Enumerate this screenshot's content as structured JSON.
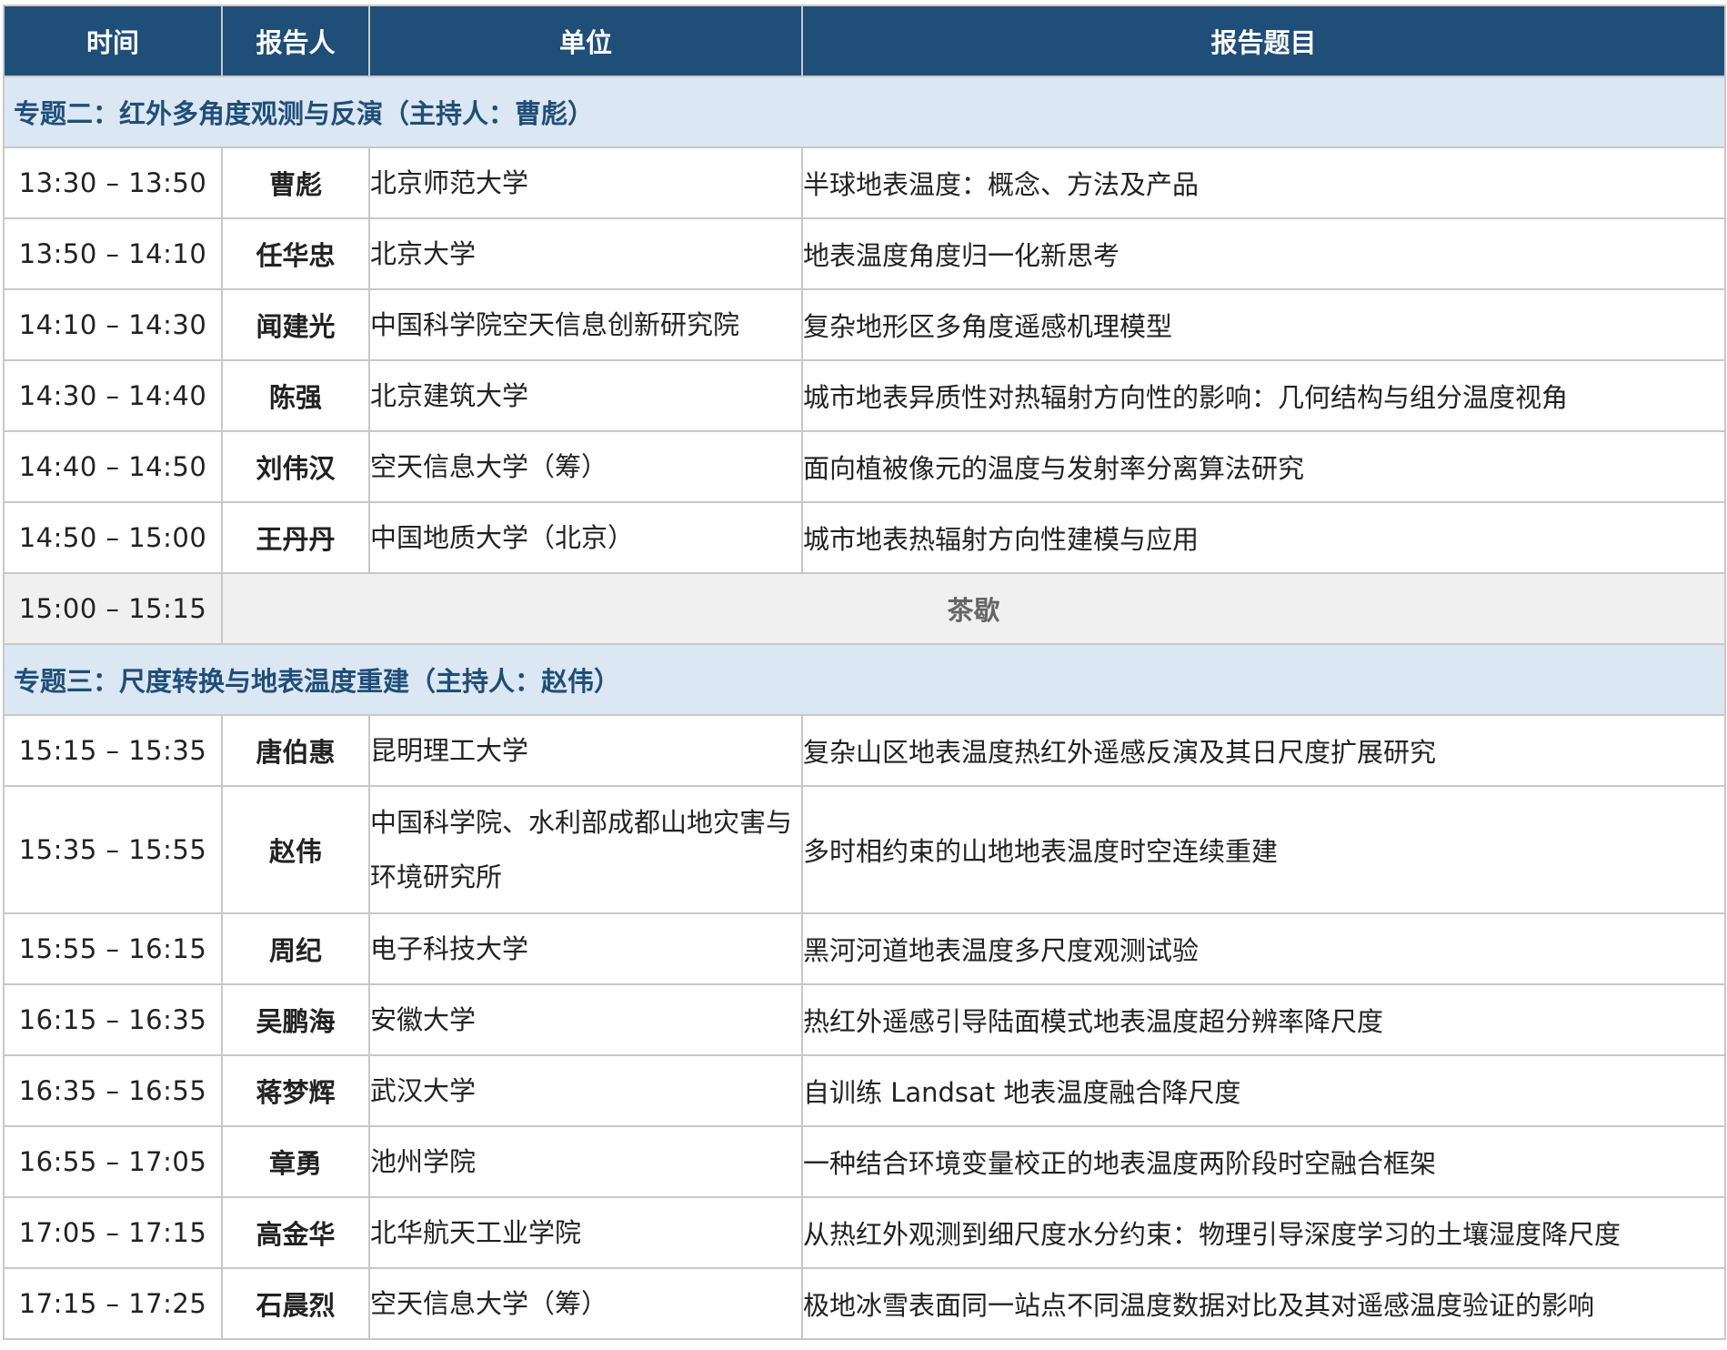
{
  "header": {
    "time": "时间",
    "speaker": "报告人",
    "unit": "单位",
    "topic": "报告题目"
  },
  "sessions": [
    {
      "title": "专题二：红外多角度观测与反演（主持人：曹彪）",
      "talks": [
        {
          "time": "13:30 – 13:50",
          "speaker": "曹彪",
          "unit": "北京师范大学",
          "topic": "半球地表温度：概念、方法及产品"
        },
        {
          "time": "13:50 – 14:10",
          "speaker": "任华忠",
          "unit": "北京大学",
          "topic": "地表温度角度归一化新思考"
        },
        {
          "time": "14:10 – 14:30",
          "speaker": "闻建光",
          "unit": "中国科学院空天信息创新研究院",
          "topic": "复杂地形区多角度遥感机理模型"
        },
        {
          "time": "14:30 – 14:40",
          "speaker": "陈强",
          "unit": "北京建筑大学",
          "topic": "城市地表异质性对热辐射方向性的影响：几何结构与组分温度视角"
        },
        {
          "time": "14:40 – 14:50",
          "speaker": "刘伟汉",
          "unit": "空天信息大学（筹）",
          "topic": "面向植被像元的温度与发射率分离算法研究"
        },
        {
          "time": "14:50 – 15:00",
          "speaker": "王丹丹",
          "unit": "中国地质大学（北京）",
          "topic": "城市地表热辐射方向性建模与应用"
        }
      ]
    },
    {
      "title": "专题三：尺度转换与地表温度重建（主持人：赵伟）",
      "talks": [
        {
          "time": "15:15 – 15:35",
          "speaker": "唐伯惠",
          "unit": "昆明理工大学",
          "topic": "复杂山区地表温度热红外遥感反演及其日尺度扩展研究"
        },
        {
          "time": "15:35 – 15:55",
          "speaker": "赵伟",
          "unit": "中国科学院、水利部成都山地灾害与环境研究所",
          "topic": "多时相约束的山地地表温度时空连续重建"
        },
        {
          "time": "15:55 – 16:15",
          "speaker": "周纪",
          "unit": "电子科技大学",
          "topic": "黑河河道地表温度多尺度观测试验"
        },
        {
          "time": "16:15 – 16:35",
          "speaker": "吴鹏海",
          "unit": "安徽大学",
          "topic": "热红外遥感引导陆面模式地表温度超分辨率降尺度"
        },
        {
          "time": "16:35 – 16:55",
          "speaker": "蒋梦辉",
          "unit": "武汉大学",
          "topic": "自训练 Landsat 地表温度融合降尺度"
        },
        {
          "time": "16:55 – 17:05",
          "speaker": "章勇",
          "unit": "池州学院",
          "topic": "一种结合环境变量校正的地表温度两阶段时空融合框架"
        },
        {
          "time": "17:05 – 17:15",
          "speaker": "高金华",
          "unit": "北华航天工业学院",
          "topic": "从热红外观测到细尺度水分约束：物理引导深度学习的土壤湿度降尺度"
        },
        {
          "time": "17:15 – 17:25",
          "speaker": "石晨烈",
          "unit": "空天信息大学（筹）",
          "topic": "极地冰雪表面同一站点不同温度数据对比及其对遥感温度验证的影响"
        }
      ]
    }
  ],
  "break": {
    "time": "15:00 – 15:15",
    "label": "茶歇"
  },
  "colors": {
    "header_bg": "#1f4e79",
    "section_bg": "#dbe7f3",
    "section_text": "#1f4e79",
    "break_bg": "#f0f0f0",
    "grid": "#c8c8c8"
  }
}
